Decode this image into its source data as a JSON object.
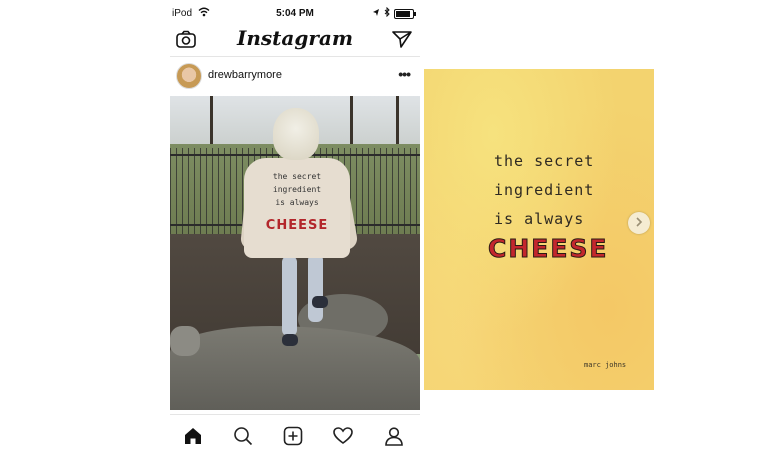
{
  "status_bar": {
    "carrier": "iPod",
    "time": "5:04 PM"
  },
  "app": {
    "logo_text": "Instagram"
  },
  "post": {
    "username": "drewbarrymore",
    "more_label": "•••",
    "jacket_text": [
      "the secret",
      "ingredient",
      "is always"
    ],
    "jacket_highlight": "CHEESE"
  },
  "card": {
    "lines": [
      "the secret",
      "ingredient",
      "is always"
    ],
    "highlight": "CHEESE",
    "signature": "marc johns"
  },
  "tab_bar": {
    "icons": [
      "home-icon",
      "search-icon",
      "add-post-icon",
      "activity-heart-icon",
      "profile-icon"
    ]
  },
  "colors": {
    "card_bg": "#f3d36f",
    "cheese_red": "#c3272d"
  }
}
